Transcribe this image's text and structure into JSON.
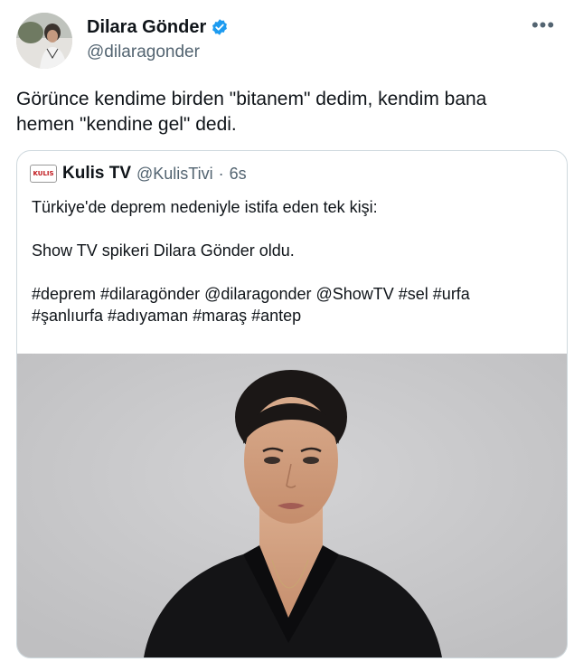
{
  "author": {
    "name": "Dilara Gönder",
    "handle": "@dilaragonder",
    "verified_color": "#1d9bf0"
  },
  "menu_icon": "more-horizontal-icon",
  "menu_glyph": "•••",
  "tweet": {
    "text": "Görünce kendime birden \"bitanem\" dedim, kendim bana\nhemen \"kendine gel\" dedi."
  },
  "quote": {
    "logo_text": "KULIS",
    "name": "Kulis TV",
    "handle": "@KulisTivi",
    "separator": "·",
    "time": "6s",
    "text": "Türkiye'de deprem nedeniyle istifa eden tek kişi:\n\nShow TV spikeri Dilara Gönder oldu.\n\n#deprem #dilaragönder @dilaragonder @ShowTV #sel #urfa\n#şanlıurfa #adıyaman #maraş #antep"
  },
  "colors": {
    "text": "#0f1419",
    "secondary": "#536471",
    "border": "#cfd9de"
  }
}
